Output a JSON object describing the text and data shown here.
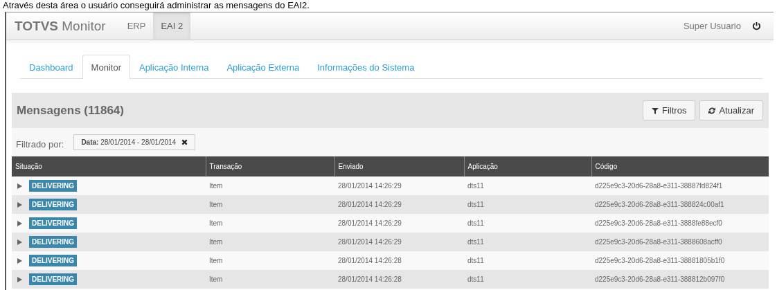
{
  "caption": "Através desta área o usuário conseguirá administrar as mensagens do EAI2.",
  "navbar": {
    "brand": "**TOTVS** Monitor",
    "menu": [
      {
        "label": "ERP",
        "selected": false
      },
      {
        "label": "EAI 2",
        "selected": true
      }
    ],
    "user": "Super Usuario"
  },
  "tabs": [
    {
      "label": "Dashboard",
      "selected": false
    },
    {
      "label": "Monitor",
      "selected": true
    },
    {
      "label": "Aplicação Interna",
      "selected": false
    },
    {
      "label": "Aplicação Externa",
      "selected": false
    },
    {
      "label": "Informações do Sistema",
      "selected": false
    }
  ],
  "panel": {
    "title": "Mensagens (11864)",
    "buttons": [
      {
        "label": "Filtros",
        "kind": "filter"
      },
      {
        "label": "Atualizar",
        "kind": "refresh"
      }
    ],
    "filter_label": "Filtrado por:",
    "filter_chip": "**Data:** 28/01/2014 - 28/01/2014",
    "table": {
      "columns": [
        "Situação",
        "Transação",
        "Enviado",
        "Aplicação",
        "Código"
      ],
      "rows": [
        {
          "status": "DELIVERING",
          "transaction": "Item",
          "sent": "28/01/2014 14:26:29",
          "application": "dts11",
          "code": "d225e9c3-20d6-28a8-e311-38887fd824f1"
        },
        {
          "status": "DELIVERING",
          "transaction": "Item",
          "sent": "28/01/2014 14:26:29",
          "application": "dts11",
          "code": "d225e9c3-20d6-28a8-e311-388824c00af1"
        },
        {
          "status": "DELIVERING",
          "transaction": "Item",
          "sent": "28/01/2014 14:26:29",
          "application": "dts11",
          "code": "d225e9c3-20d6-28a8-e311-3888fe88ecf0"
        },
        {
          "status": "DELIVERING",
          "transaction": "Item",
          "sent": "28/01/2014 14:26:29",
          "application": "dts11",
          "code": "d225e9c3-20d6-28a8-e311-3888608acff0"
        },
        {
          "status": "DELIVERING",
          "transaction": "Item",
          "sent": "28/01/2014 14:26:28",
          "application": "dts11",
          "code": "d225e9c3-20d6-28a8-e311-38881805b1f0"
        },
        {
          "status": "DELIVERING",
          "transaction": "Item",
          "sent": "28/01/2014 14:26:28",
          "application": "dts11",
          "code": "d225e9c3-20d6-28a8-e311-388812b097f0"
        }
      ]
    }
  }
}
